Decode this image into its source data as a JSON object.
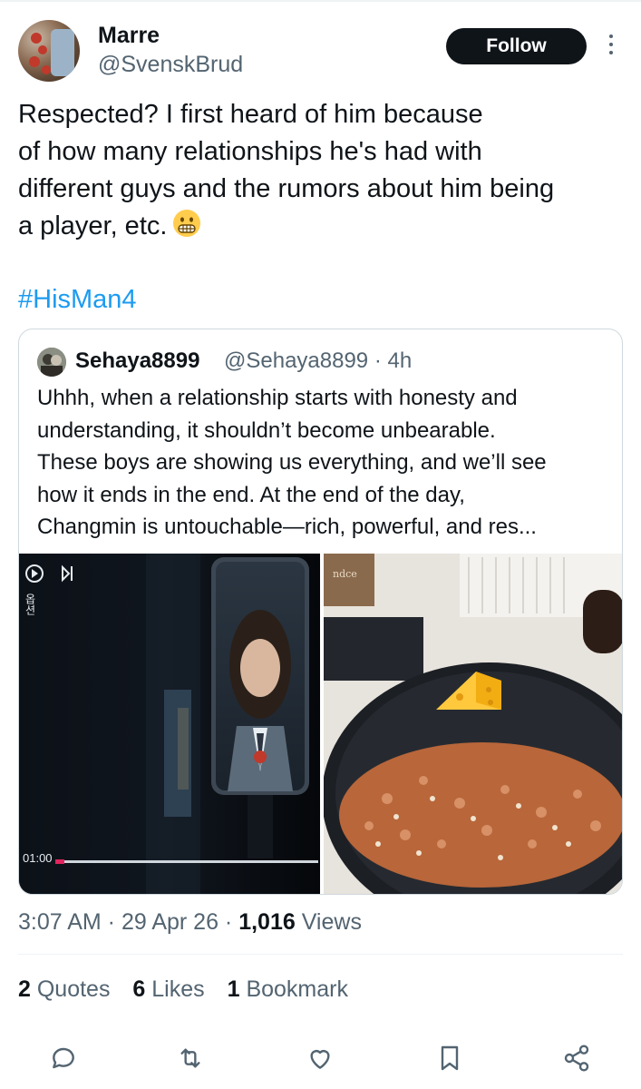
{
  "author": {
    "name": "Marre",
    "handle": "@SvenskBrud"
  },
  "follow_label": "Follow",
  "tweet": {
    "lines": [
      "Respected? I first heard of him because",
      "of how many relationships he's had with",
      "different guys and the rumors about him being",
      "a player, etc."
    ],
    "emoji": "grimacing-face",
    "hashtag": "#HisMan4"
  },
  "quoted": {
    "name": "Sehaya8899",
    "meta": "@Sehaya8899 · 4h",
    "lines": [
      "Uhhh, when a relationship starts with honesty and",
      "understanding, it shouldn’t become unbearable.",
      "These boys are showing us everything, and we’ll see",
      "how it ends in the end. At the end of the day,",
      "Changmin is untouchable—rich, powerful, and res..."
    ],
    "media": [
      {
        "desc_icon": "video-player-screenshot",
        "time": "01:00",
        "side_label": "옵션"
      },
      {
        "desc_icon": "frying-pan-photo",
        "bag_text": "ndce"
      }
    ]
  },
  "timestamp": {
    "time": "3:07 AM",
    "sep1": " · ",
    "date": "29 Apr 26",
    "sep2": " · ",
    "views_count": "1,016",
    "views_label": " Views"
  },
  "stats": {
    "quotes_count": "2",
    "quotes_label": " Quotes",
    "likes_count": "6",
    "likes_label": " Likes",
    "bookmarks_count": "1",
    "bookmarks_label": " Bookmark"
  },
  "actions": [
    "reply-icon",
    "retweet-icon",
    "like-icon",
    "bookmark-icon",
    "share-icon"
  ],
  "colors": {
    "link": "#1d9bf0",
    "secondary": "#536471",
    "text": "#0f1419",
    "border": "#cfd9de"
  }
}
